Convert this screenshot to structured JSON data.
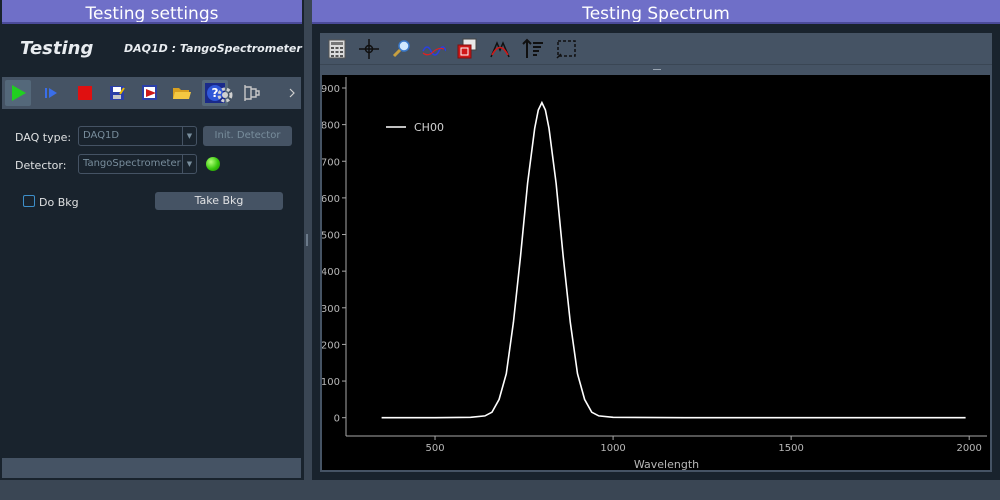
{
  "left_dock": {
    "title": "Testing settings",
    "app_title": "Testing",
    "detector_info": "DAQ1D : TangoSpectrometer",
    "toolbar": {
      "icons": [
        "play-icon",
        "run-step-icon",
        "stop-icon",
        "save-icon",
        "save-red-icon",
        "open-folder-icon",
        "help-icon",
        "settings-gear-icon",
        "log-icon",
        "more-chevron-icon"
      ]
    },
    "daq_type_label": "DAQ type:",
    "daq_type_value": "DAQ1D",
    "init_detector_label": "Init. Detector",
    "detector_label": "Detector:",
    "detector_value": "TangoSpectrometer",
    "do_bkg_label": "Do Bkg",
    "do_bkg_checked": false,
    "take_bkg_label": "Take Bkg",
    "status_color": "#38c80c"
  },
  "right_dock": {
    "title": "Testing Spectrum",
    "toolbar": {
      "icons": [
        "calculator-icon",
        "crosshair-icon",
        "zoom-icon",
        "wave-icon",
        "roi-icon",
        "fit-icon",
        "sort-icon",
        "select-region-icon"
      ]
    }
  },
  "colors": {
    "title_bar": "#6f6fc8",
    "dock_bg": "#19232d",
    "panel": "#455364",
    "plot_bg": "#000000",
    "trace": "#ffffff"
  },
  "chart_data": {
    "type": "line",
    "xlabel": "Wavelength",
    "ylabel": "",
    "xlim": [
      250,
      2050
    ],
    "ylim": [
      -50,
      930
    ],
    "x_ticks": [
      500,
      1000,
      1500,
      2000
    ],
    "y_ticks": [
      0,
      100,
      200,
      300,
      400,
      500,
      600,
      700,
      800,
      900
    ],
    "legend_position": "top-left",
    "series": [
      {
        "name": "CH00",
        "color": "#ffffff",
        "x": [
          350,
          500,
          600,
          640,
          660,
          680,
          700,
          720,
          740,
          760,
          780,
          790,
          800,
          810,
          820,
          840,
          860,
          880,
          900,
          920,
          940,
          960,
          1000,
          1200,
          1500,
          1800,
          1990
        ],
        "y": [
          0,
          0,
          1,
          5,
          15,
          50,
          120,
          260,
          440,
          640,
          790,
          840,
          860,
          840,
          790,
          640,
          440,
          260,
          120,
          50,
          15,
          5,
          1,
          0,
          0,
          0,
          0
        ]
      }
    ]
  }
}
